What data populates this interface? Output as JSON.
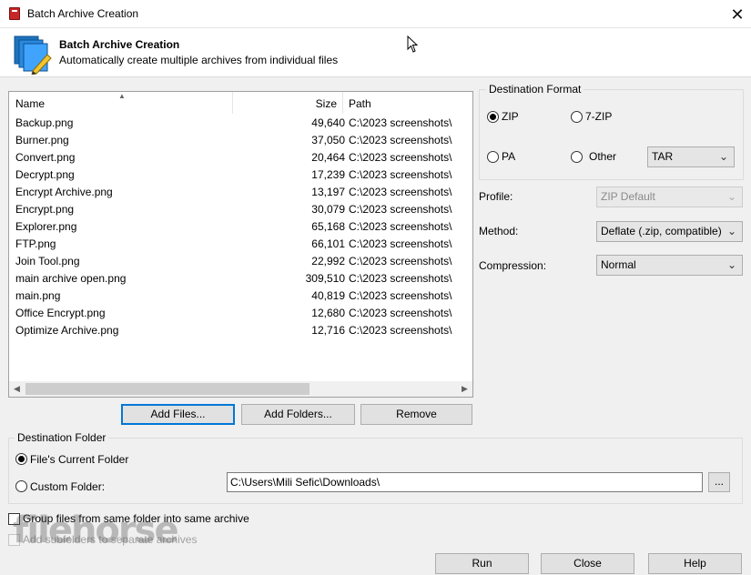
{
  "window": {
    "title": "Batch Archive Creation",
    "close_glyph": "✕"
  },
  "header": {
    "title": "Batch Archive Creation",
    "subtitle": "Automatically create multiple archives from individual files"
  },
  "file_list": {
    "columns": {
      "name": "Name",
      "size": "Size",
      "path": "Path"
    },
    "rows": [
      {
        "name": "Backup.png",
        "size": "49,640",
        "path": "C:\\2023 screenshots\\"
      },
      {
        "name": "Burner.png",
        "size": "37,050",
        "path": "C:\\2023 screenshots\\"
      },
      {
        "name": "Convert.png",
        "size": "20,464",
        "path": "C:\\2023 screenshots\\"
      },
      {
        "name": "Decrypt.png",
        "size": "17,239",
        "path": "C:\\2023 screenshots\\"
      },
      {
        "name": "Encrypt Archive.png",
        "size": "13,197",
        "path": "C:\\2023 screenshots\\"
      },
      {
        "name": "Encrypt.png",
        "size": "30,079",
        "path": "C:\\2023 screenshots\\"
      },
      {
        "name": "Explorer.png",
        "size": "65,168",
        "path": "C:\\2023 screenshots\\"
      },
      {
        "name": "FTP.png",
        "size": "66,101",
        "path": "C:\\2023 screenshots\\"
      },
      {
        "name": "Join Tool.png",
        "size": "22,992",
        "path": "C:\\2023 screenshots\\"
      },
      {
        "name": "main archive open.png",
        "size": "309,510",
        "path": "C:\\2023 screenshots\\"
      },
      {
        "name": "main.png",
        "size": "40,819",
        "path": "C:\\2023 screenshots\\"
      },
      {
        "name": "Office Encrypt.png",
        "size": "12,680",
        "path": "C:\\2023 screenshots\\"
      },
      {
        "name": "Optimize Archive.png",
        "size": "12,716",
        "path": "C:\\2023 screenshots\\"
      }
    ]
  },
  "list_buttons": {
    "add_files": "Add Files...",
    "add_folders": "Add Folders...",
    "remove": "Remove"
  },
  "destination_format": {
    "label": "Destination Format",
    "zip": "ZIP",
    "sevenzip": "7-ZIP",
    "pa": "PA",
    "other": "Other",
    "other_value": "TAR",
    "selected": "ZIP"
  },
  "options": {
    "profile_label": "Profile:",
    "profile_value": "ZIP Default",
    "method_label": "Method:",
    "method_value": "Deflate (.zip, compatible)",
    "compression_label": "Compression:",
    "compression_value": "Normal"
  },
  "destination_folder": {
    "label": "Destination Folder",
    "current_option": "File's Current Folder",
    "custom_option": "Custom Folder:",
    "custom_path": "C:\\Users\\Mili Sefic\\Downloads\\",
    "browse_label": "...",
    "selected": "File's Current Folder"
  },
  "checkboxes": {
    "group_files": "Group files from same folder into same archive",
    "add_subfolders": "Add subfolders to separate archives"
  },
  "footer_buttons": {
    "run": "Run",
    "close": "Close",
    "help": "Help"
  },
  "watermark": "filehorse",
  "icons": {
    "app": "app-icon",
    "banner": "batch-archive-icon",
    "cursor": "mouse-cursor-icon"
  }
}
